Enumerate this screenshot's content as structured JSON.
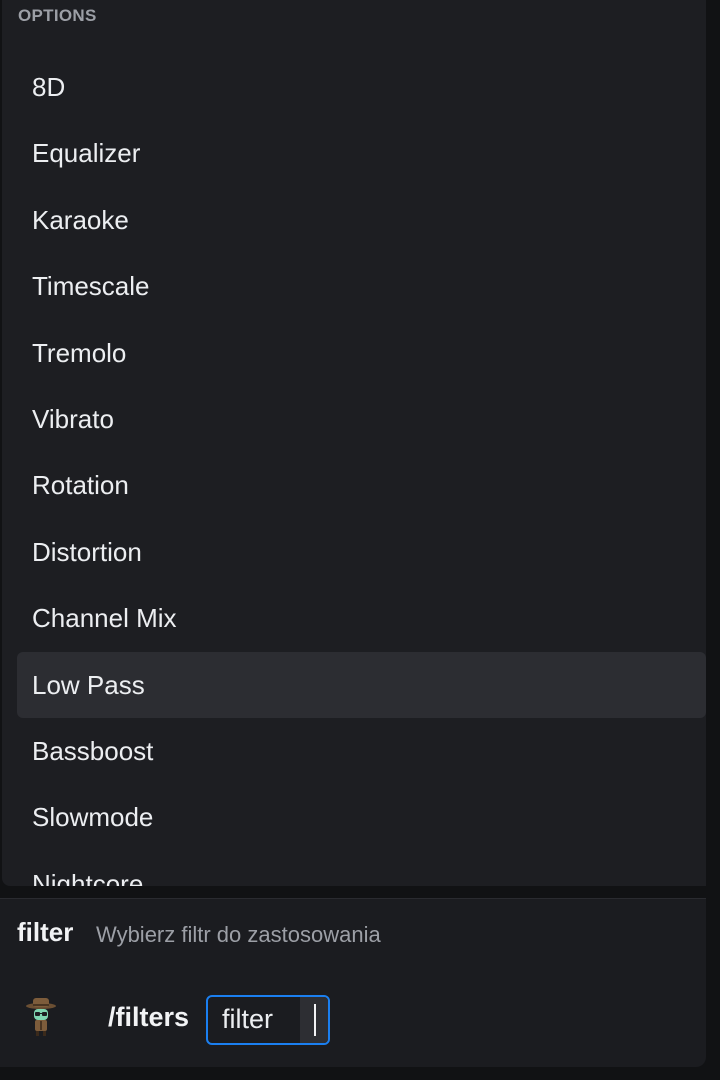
{
  "autocomplete": {
    "header": "OPTIONS",
    "options": [
      "8D",
      "Equalizer",
      "Karaoke",
      "Timescale",
      "Tremolo",
      "Vibrato",
      "Rotation",
      "Distortion",
      "Channel Mix",
      "Low Pass",
      "Bassboost",
      "Slowmode",
      "Nightcore"
    ],
    "selected_option": "Low Pass"
  },
  "argument_hint": {
    "name": "filter",
    "description": "Wybierz filtr do zastosowania"
  },
  "input": {
    "command": "/filters",
    "option_label": "filter",
    "option_value": ""
  },
  "icons": {
    "avatar": "detective-bot-avatar"
  },
  "colors": {
    "background": "#111214",
    "popup": "#1d1e22",
    "selected_row": "#2c2d32",
    "accent_focus": "#1b7ff0",
    "muted_text": "#9c9fa6"
  }
}
